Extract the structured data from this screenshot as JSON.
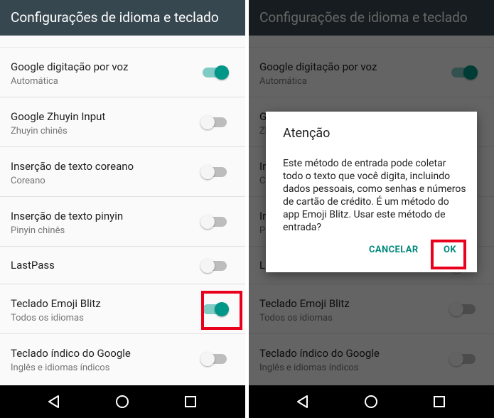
{
  "screen": {
    "title": "Configurações de idioma e teclado",
    "items": [
      {
        "title": "Google digitação por voz",
        "subtitle": "Automática",
        "enabled": true
      },
      {
        "title": "Google Zhuyin Input",
        "subtitle": "Zhuyin chinês",
        "enabled": false
      },
      {
        "title": "Inserção de texto coreano",
        "subtitle": "Coreano",
        "enabled": false
      },
      {
        "title": "Inserção de texto pinyin",
        "subtitle": "Pinyin chinês",
        "enabled": false
      },
      {
        "title": "LastPass",
        "subtitle": "",
        "enabled": false
      },
      {
        "title": "Teclado Emoji Blitz",
        "subtitle": "Todos os idiomas",
        "enabled": true
      },
      {
        "title": "Teclado índico do Google",
        "subtitle": "Inglês e idiomas índicos",
        "enabled": false
      }
    ]
  },
  "screen_after": {
    "items_enabled": [
      true,
      false,
      false,
      false,
      false,
      false,
      false
    ]
  },
  "dialog": {
    "title": "Atenção",
    "message": "Este método de entrada pode coletar todo o texto que você digita, incluindo dados pessoais, como senhas e números de cartão de crédito. É um método do app Emoji Blitz. Usar este método de entrada?",
    "cancel_label": "CANCELAR",
    "ok_label": "OK"
  },
  "colors": {
    "appbar": "#37474f",
    "accent": "#009688",
    "highlight": "#e8001c"
  },
  "icons": {
    "back": "back-triangle-icon",
    "home": "home-circle-icon",
    "recent": "recent-apps-square-icon"
  }
}
